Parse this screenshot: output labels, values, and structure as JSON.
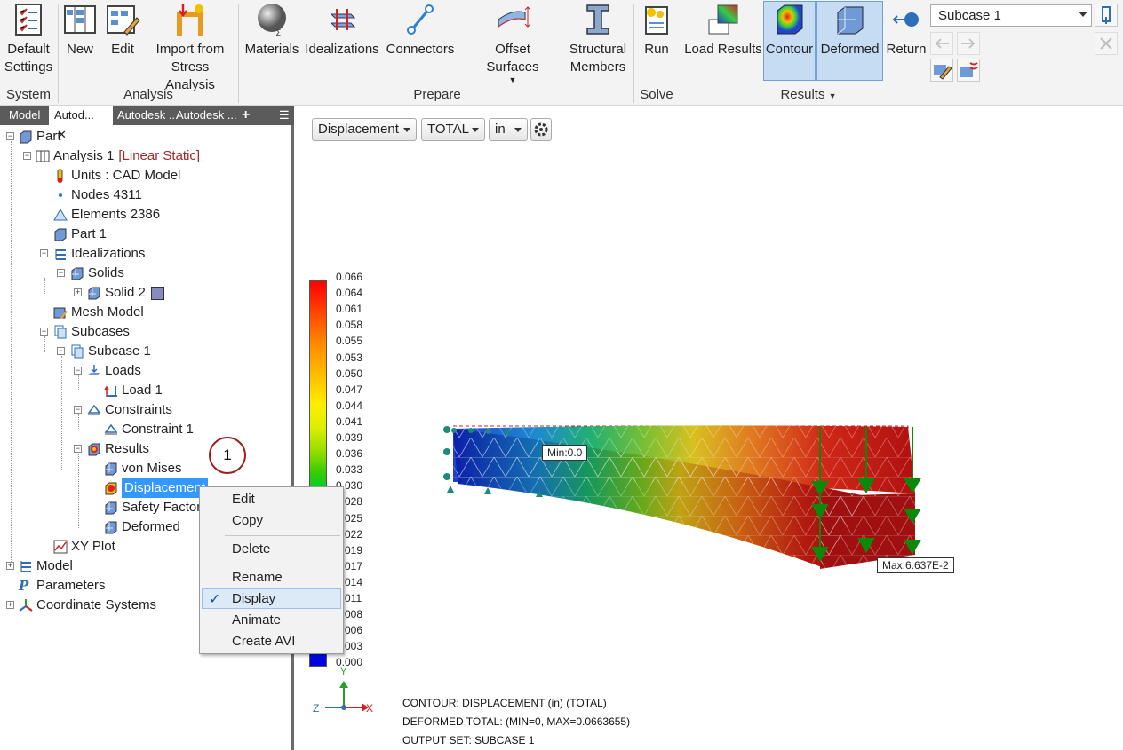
{
  "ribbon": {
    "system": {
      "default_settings": "Default\nSettings",
      "group": "System"
    },
    "analysis": {
      "new": "New",
      "edit": "Edit",
      "import": "Import from\nStress Analysis",
      "group": "Analysis"
    },
    "prepare": {
      "materials": "Materials",
      "idealizations": "Idealizations",
      "connectors": "Connectors",
      "offset_surfaces": "Offset Surfaces",
      "structural_members": "Structural\nMembers",
      "group": "Prepare"
    },
    "solve": {
      "run": "Run",
      "group": "Solve"
    },
    "results": {
      "load_results": "Load Results",
      "contour": "Contour",
      "deformed": "Deformed",
      "return": "Return",
      "group": "Results"
    },
    "subcase_value": "Subcase 1"
  },
  "browser": {
    "tabs": [
      "Model",
      "Autod...",
      "Autodesk ...",
      "Autodesk ..."
    ],
    "tree": {
      "part": "Part",
      "analysis": "Analysis 1",
      "analysis_type": "[Linear Static]",
      "units": "Units : CAD Model",
      "nodes": "Nodes 4311",
      "elements": "Elements 2386",
      "part1": "Part 1",
      "idealizations": "Idealizations",
      "solids": "Solids",
      "solid2": "Solid 2",
      "mesh_model": "Mesh Model",
      "subcases": "Subcases",
      "subcase1": "Subcase 1",
      "loads": "Loads",
      "load1": "Load 1",
      "constraints": "Constraints",
      "constraint1": "Constraint 1",
      "results": "Results",
      "von_mises": "von Mises",
      "displacement": "Displacement",
      "safety_factor": "Safety Factor",
      "deformed": "Deformed",
      "xy_plot": "XY Plot",
      "model": "Model",
      "parameters": "Parameters",
      "coord_systems": "Coordinate Systems"
    },
    "callout": "1"
  },
  "context_menu": {
    "items": [
      "Edit",
      "Copy",
      "Delete",
      "Rename",
      "Display",
      "Animate",
      "Create AVI"
    ],
    "checked": "Display"
  },
  "viewport": {
    "result_type": "Displacement",
    "component": "TOTAL",
    "unit": "in",
    "legend": [
      "0.066",
      "0.064",
      "0.061",
      "0.058",
      "0.055",
      "0.053",
      "0.050",
      "0.047",
      "0.044",
      "0.041",
      "0.039",
      "0.036",
      "0.033",
      "0.030",
      "0.028",
      "0.025",
      "0.022",
      "0.019",
      "0.017",
      "0.014",
      "0.011",
      "0.008",
      "0.006",
      "0.003",
      "0.000"
    ],
    "min_label": "Min:0.0",
    "max_label": "Max:6.637E-2",
    "captions": [
      "CONTOUR: DISPLACEMENT (in) (TOTAL)",
      "DEFORMED TOTAL: (MIN=0, MAX=0.0663655)",
      "OUTPUT SET: SUBCASE 1"
    ],
    "axes": {
      "y": "Y",
      "z": "Z",
      "x": "X"
    }
  },
  "colors": {
    "selection": "#3399ff",
    "ribbon_active": "#c5dcf3",
    "analysis_type": "#a0282d"
  }
}
